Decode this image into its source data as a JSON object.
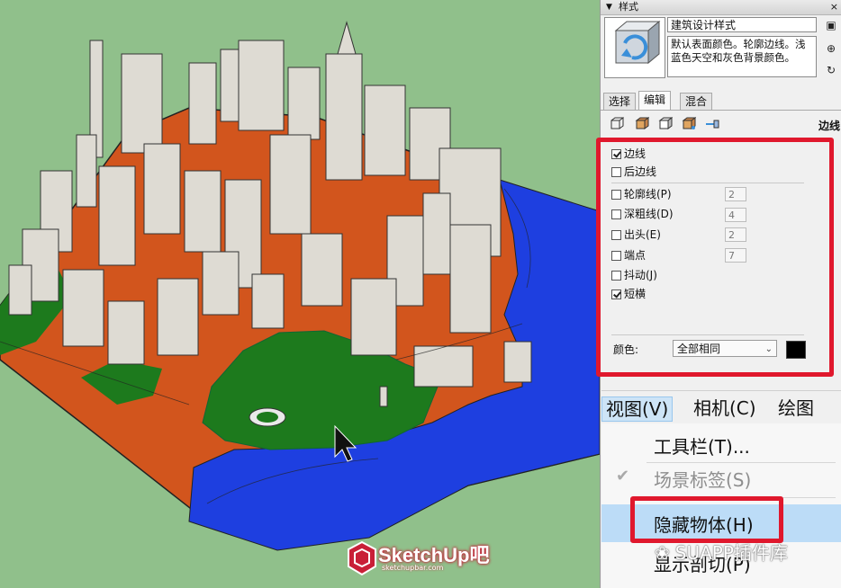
{
  "styles_panel": {
    "title": "样式",
    "close": "×",
    "style_name": "建筑设计样式",
    "style_desc": "默认表面颜色。轮廓边线。浅蓝色天空和灰色背景颜色。",
    "tabs": [
      {
        "label": "选择",
        "active": false
      },
      {
        "label": "编辑",
        "active": true
      },
      {
        "label": "混合",
        "active": false
      }
    ],
    "section_label": "边线",
    "edges": [
      {
        "label": "边线",
        "checked": true
      },
      {
        "label": "后边线",
        "checked": false
      },
      {
        "label": "轮廓线(P)",
        "checked": false,
        "value": "2"
      },
      {
        "label": "深粗线(D)",
        "checked": false,
        "value": "4"
      },
      {
        "label": "出头(E)",
        "checked": false,
        "value": "2"
      },
      {
        "label": "端点",
        "checked": false,
        "value": "7"
      },
      {
        "label": "抖动(J)",
        "checked": false
      },
      {
        "label": "短横",
        "checked": true
      }
    ],
    "color_label": "颜色:",
    "color_select": "全部相同",
    "color_value": "#000000"
  },
  "menubar": {
    "items": [
      {
        "label": "视图(V)",
        "active": true
      },
      {
        "label": "相机(C)",
        "active": false
      },
      {
        "label": "绘图(R)",
        "active": false
      }
    ]
  },
  "view_menu": {
    "items": [
      {
        "label": "工具栏(T)...",
        "disabled": false,
        "checked": false
      },
      {
        "label": "场景标签(S)",
        "disabled": true,
        "checked": true
      },
      {
        "label": "隐藏物体(H)",
        "disabled": false,
        "checked": false,
        "highlighted": true
      },
      {
        "label": "显示剖切(P)",
        "disabled": false,
        "checked": false
      }
    ]
  },
  "watermarks": {
    "logo": "SketchUp吧",
    "logo_url": "sketchupbar.com",
    "wechat": "SUAPP插件库"
  },
  "colors": {
    "ground": "#90c08b",
    "roads": "#d2551d",
    "water": "#1e3fe0",
    "park": "#1d7a1d",
    "buildings": "#dedbd3",
    "highlight_box": "#e0182d"
  }
}
